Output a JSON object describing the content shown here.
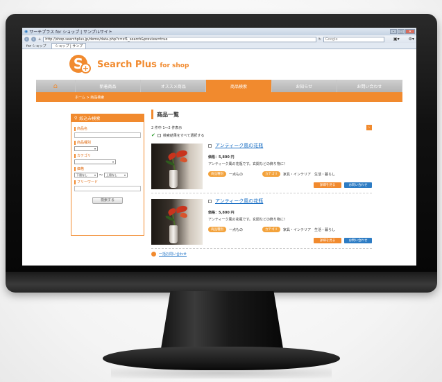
{
  "browser": {
    "window_title": "サーチプラス for ショップ | サンプルサイト",
    "url": "http://shop.searchplus.jp/demo/data.php?c=sf1_search&preview=true",
    "search_placeholder": "Google",
    "tabs": [
      {
        "label": "for ショップ"
      },
      {
        "label": "ショップ | サンプ"
      }
    ]
  },
  "site": {
    "logo_text": "Search Plus",
    "logo_suffix": "for shop"
  },
  "nav": {
    "items": [
      {
        "label": "新着商品"
      },
      {
        "label": "オススメ商品"
      },
      {
        "label": "商品検索"
      },
      {
        "label": "お知らせ"
      },
      {
        "label": "お問い合わせ"
      }
    ],
    "breadcrumb": "ホーム > 商品検索"
  },
  "sidebar": {
    "title": "絞込み検索",
    "fields": {
      "name_label": "商品名",
      "type_label": "商品種別",
      "category_label": "カテゴリ",
      "price_label": "価格",
      "price_min": "下限なし",
      "price_separator": "〜",
      "price_max": "上限なし",
      "keyword_label": "フリーワード"
    },
    "search_button": "検索する"
  },
  "main": {
    "title": "商品一覧",
    "result_text": "2 件中 1〜2 件表示",
    "pager_label": "›",
    "select_all": "検索結果をすべて選択する",
    "items": [
      {
        "name": "アンティーク風の花瓶",
        "price": "価格：5,800 円",
        "desc": "アンティーク風の花瓶です。玄関などの飾り物に！",
        "type_tag": "商品種別",
        "type_value": "一点もの",
        "category_tag": "カテゴリ",
        "category_value": "家具・インテリア　生活・暮らし",
        "detail_button": "詳細を見る",
        "inquiry_button": "お問い合わせ"
      },
      {
        "name": "アンティーク風の花瓶",
        "price": "価格：5,800 円",
        "desc": "アンティーク風の花瓶です。玄関などの飾り物に！",
        "type_tag": "商品種別",
        "type_value": "一点もの",
        "category_tag": "カテゴリ",
        "category_value": "家具・インテリア　生活・暮らし",
        "detail_button": "詳細を見る",
        "inquiry_button": "お問い合わせ"
      }
    ],
    "bulk_inquiry": "一括お問い合わせ"
  },
  "colors": {
    "accent": "#f18a2e",
    "link": "#1a6fc4",
    "inquiry": "#2d7cc4"
  }
}
